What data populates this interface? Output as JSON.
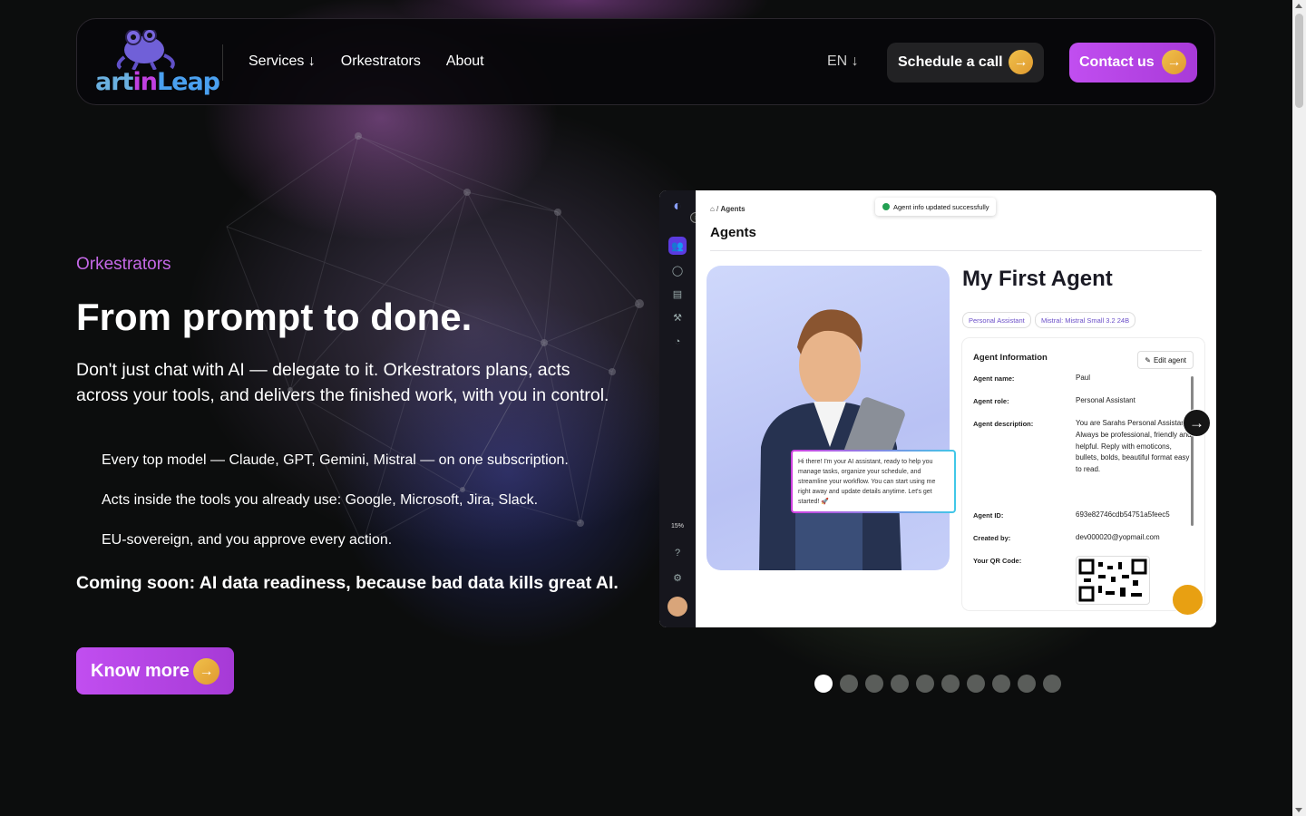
{
  "header": {
    "logo_text": [
      "art",
      "in",
      "Leap"
    ],
    "nav": [
      {
        "label": "Services ↓"
      },
      {
        "label": "Orkestrators"
      },
      {
        "label": "About"
      }
    ],
    "language": "EN ↓",
    "schedule_label": "Schedule a call",
    "contact_label": "Contact us"
  },
  "hero": {
    "eyebrow": "Orkestrators",
    "title": "From prompt to done.",
    "description": "Don't just chat with AI — delegate to it. Orkestrators plans, acts across your tools, and delivers the finished work, with you in control.",
    "bullets": [
      "Every top model — Claude, GPT, Gemini, Mistral — on one subscription.",
      "Acts inside the tools you already use: Google, Microsoft, Jira, Slack.",
      "EU-sovereign, and you approve every action."
    ],
    "coming_soon": "Coming soon: AI data readiness, because bad data kills great AI.",
    "cta_label": "Know more"
  },
  "screenshot": {
    "breadcrumb": "Agents",
    "page_title": "Agents",
    "toast": "Agent info updated successfully",
    "agent_title": "My First Agent",
    "tags": [
      "Personal Assistant",
      "Mistral: Mistral Small 3.2 24B"
    ],
    "sidebar_progress": "15%",
    "bubble_text": "Hi there! I'm your AI assistant, ready to help you manage tasks, organize your schedule, and streamline your workflow. You can start using me right away and update details anytime. Let's get started! 🚀",
    "info": {
      "title": "Agent Information",
      "edit_label": "Edit agent",
      "fields": [
        {
          "label": "Agent name:",
          "value": "Paul"
        },
        {
          "label": "Agent role:",
          "value": "Personal Assistant"
        },
        {
          "label": "Agent description:",
          "value": "You are Sarahs Personal Assistant. Always be professional, friendly and helpful. Reply with emoticons, bullets, bolds, beautiful format easy to read."
        },
        {
          "label": "Agent ID:",
          "value": "693e82746cdb54751a5feec5"
        },
        {
          "label": "Created by:",
          "value": "dev000020@yopmail.com"
        },
        {
          "label": "Your QR Code:",
          "value": ""
        }
      ]
    }
  },
  "carousel": {
    "count": 10,
    "active_index": 0
  }
}
